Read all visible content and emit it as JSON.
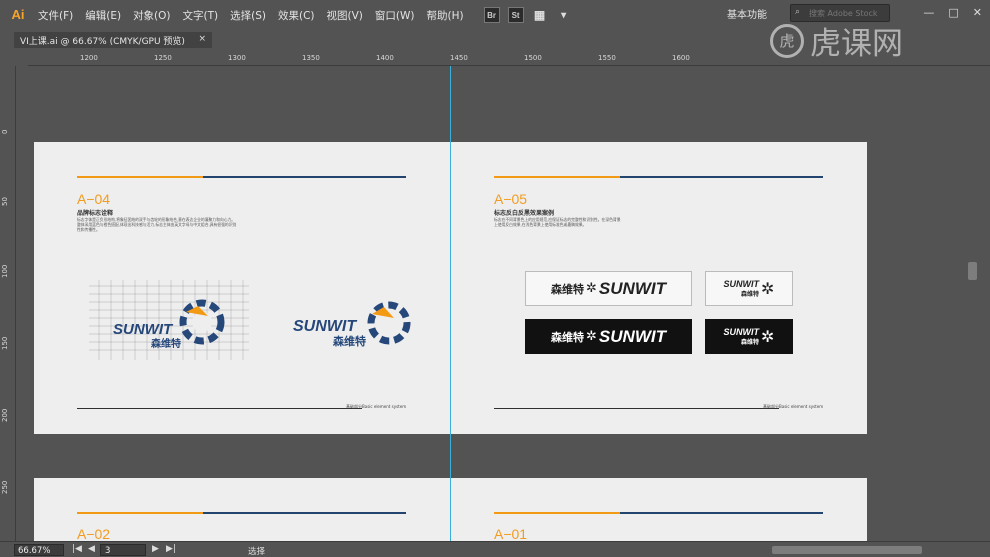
{
  "app": {
    "logo": "Ai",
    "menu": [
      "文件(F)",
      "编辑(E)",
      "对象(O)",
      "文字(T)",
      "选择(S)",
      "效果(C)",
      "视图(V)",
      "窗口(W)",
      "帮助(H)"
    ],
    "toolbar_icons": [
      "bridge-icon",
      "stock-icon",
      "arrange-documents-icon",
      "chevron-down-icon"
    ],
    "toolbar_labels": {
      "br": "Br",
      "st": "St"
    },
    "workspace": "基本功能",
    "search_placeholder": "搜索 Adobe Stock",
    "window_controls": [
      "—",
      "□",
      "✕"
    ]
  },
  "document_tab": {
    "label": "VI上课.ai @ 66.67% (CMYK/GPU 预览)",
    "close": "×"
  },
  "watermark": {
    "circle": "虎",
    "text": "虎课网"
  },
  "rulers": {
    "horizontal": [
      "1200",
      "1250",
      "1300",
      "1350",
      "1400",
      "1450",
      "1500",
      "1550",
      "1600"
    ],
    "vertical": [
      "0",
      "50",
      "100",
      "150",
      "200",
      "250"
    ]
  },
  "artboard_left": {
    "section_num": "A−04",
    "section_title": "品牌标志诠释",
    "paragraph": "标志字体是正负形结构,将象征团结的双手与齿轮的形象结合,意在表达企业的凝聚力和向心力。整体采用蓝色与橙色搭配,体现出科技感与活力,标志主体由英文字母与中文组合,具有很强的识别性和传播性。",
    "logo_en": "SUNWIT",
    "logo_cn": "森维特",
    "footer": "基础部分Basic element system"
  },
  "artboard_right": {
    "section_num": "A−05",
    "section_title": "标志反白反黑效果案例",
    "paragraph": "标志在不同背景色上的应用规范,应保证标志的完整性和识别性。在深色背景上使用反白效果,在浅色背景上使用标准色或墨稿效果。",
    "demo_cn": "森维特",
    "demo_en": "SUNWIT",
    "footer": "基础部分Basic element system"
  },
  "next_row": {
    "left_num": "A−02",
    "right_num": "A−01"
  },
  "colors": {
    "orange": "#f39a14",
    "blue": "#23446f",
    "guide": "#3ab0d8"
  },
  "status": {
    "zoom": "66.67%",
    "page": "3",
    "tool": "选择"
  }
}
